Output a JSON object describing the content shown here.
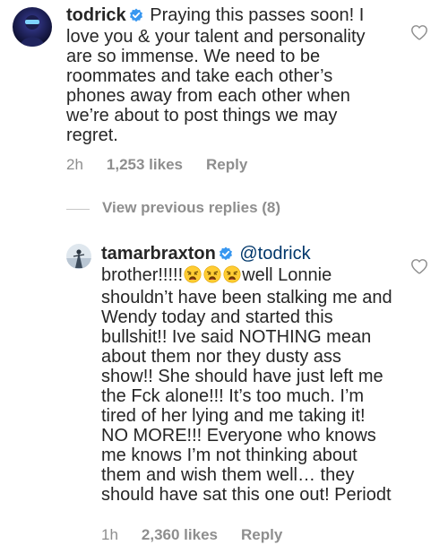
{
  "comments": [
    {
      "username": "todrick",
      "verified": true,
      "text": "Praying this passes soon! I love you & your talent and personality are so immense. We need to be roommates and take each other’s phones away from each other when we’re about to post things we may regret.",
      "time": "2h",
      "likes": "1,253 likes",
      "reply_label": "Reply",
      "avatar_icon": "todrick-avatar"
    },
    {
      "username": "tamarbraxton",
      "verified": true,
      "mention": "@todrick",
      "text_before_emoji": "brother!!!!!",
      "emoji_count": 3,
      "emoji_icon": "weary-face-emoji",
      "text_after_emoji": "well Lonnie shouldn’t have been stalking me and Wendy today and started this bullshit!! Ive said NOTHING mean about them nor they dusty ass show!! She should have just left me the Fck alone!!! It’s too much. I’m tired of her lying and me taking it! NO MORE!!! Everyone who knows me knows I’m not thinking about them and wish them well… they should have sat this one out! Periodt",
      "time": "1h",
      "likes": "2,360 likes",
      "reply_label": "Reply",
      "avatar_icon": "tamarbraxton-avatar"
    }
  ],
  "view_previous_replies": "View previous replies (8)",
  "colors": {
    "text": "#262626",
    "meta": "#8e8e8e",
    "mention": "#00376b",
    "verified": "#3897f0",
    "heart": "#8e8e8e"
  }
}
